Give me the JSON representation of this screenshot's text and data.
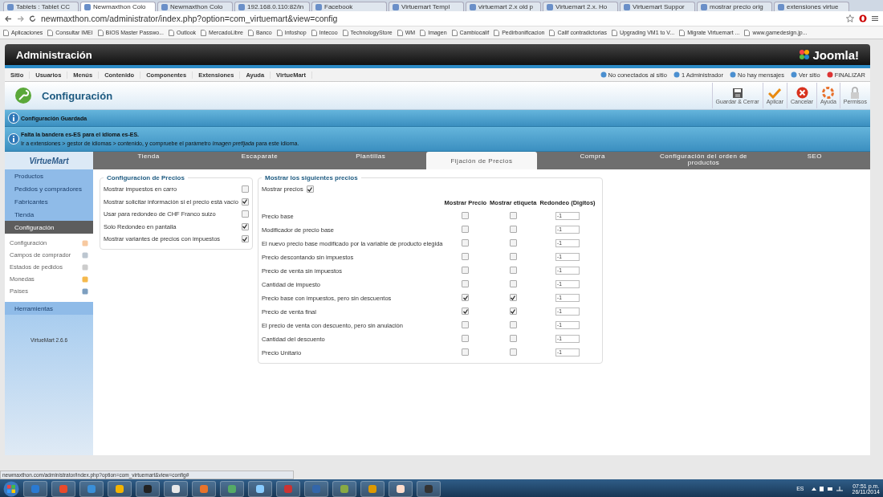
{
  "browser": {
    "tabs": [
      {
        "title": "Tablets : Tablet CC",
        "selected": false
      },
      {
        "title": "Newmaxthon Colo",
        "selected": true
      },
      {
        "title": "Newmaxthon Colo",
        "selected": false
      },
      {
        "title": "192.168.0.110:82/in",
        "selected": false
      },
      {
        "title": "Facebook",
        "selected": false
      },
      {
        "title": "Virtuemart Templ",
        "selected": false
      },
      {
        "title": "virtuemart 2.x old p",
        "selected": false
      },
      {
        "title": "Virtuemart 2.x. Ho",
        "selected": false
      },
      {
        "title": "Virtuemart Suppor",
        "selected": false
      },
      {
        "title": "mostrar precio orig",
        "selected": false
      },
      {
        "title": "extensiones virtue",
        "selected": false
      }
    ],
    "address": "newmaxthon.com/administrator/index.php?option=com_virtuemart&view=config",
    "bookmarks": [
      "Aplicaciones",
      "Consultar IMEI",
      "BIOS Master Passwo...",
      "Outlook",
      "MercadoLibre",
      "Banco",
      "Infoshop",
      "Intecoo",
      "TechnologyStore",
      "WM",
      "Imagen",
      "Cambiocalif",
      "Pedirbonificacion",
      "Calif contradictorias",
      "Upgrading VM1 to V...",
      "Migrate Virtuemart ...",
      "www.gamedesign.jp..."
    ],
    "status_url": "newmaxthon.com/administrator/index.php?option=com_virtuemart&view=config#"
  },
  "header": {
    "title": "Administración",
    "logo": "Joomla!"
  },
  "menu": [
    "Sitio",
    "Usuarios",
    "Menús",
    "Contenido",
    "Componentes",
    "Extensiones",
    "Ayuda",
    "VirtueMart"
  ],
  "status_links": [
    "No conectados al sitio",
    "1 Administrador",
    "No hay mensajes",
    "Ver sitio",
    "FINALIZAR"
  ],
  "toolbar": {
    "title": "Configuración",
    "buttons": [
      {
        "label": "Guardar & Cerrar",
        "kind": "save"
      },
      {
        "label": "Aplicar",
        "kind": "apply"
      },
      {
        "label": "Cancelar",
        "kind": "cancel"
      },
      {
        "label": "Ayuda",
        "kind": "help"
      },
      {
        "label": "Permisos",
        "kind": "lock"
      }
    ]
  },
  "messages": [
    {
      "lines": [
        "**Configuración Guardada**"
      ]
    },
    {
      "lines": [
        "**Falta la bandera es-ES para el idioma es-ES.**",
        "Ir a extensiones > gestor de idiomas > contenido, y compruebe el parámetro *Imagen prefijada* para este idioma."
      ]
    }
  ],
  "sidebar": {
    "logo": "VirtueMart",
    "sections": [
      {
        "label": "Productos",
        "selected": false
      },
      {
        "label": "Pedidos y compradores",
        "selected": false
      },
      {
        "label": "Fabricantes",
        "selected": false
      },
      {
        "label": "Tienda",
        "selected": false
      },
      {
        "label": "Configuración",
        "selected": true
      }
    ],
    "subitems": [
      "Configuración",
      "Campos de comprador",
      "Estados de pedidos",
      "Monedas",
      "Países"
    ],
    "tools": "Herramientas",
    "version": "VirtueMart 2.6.6"
  },
  "tabs": [
    {
      "label": "Tienda",
      "selected": false
    },
    {
      "label": "Escaparate",
      "selected": false
    },
    {
      "label": "Plantillas",
      "selected": false
    },
    {
      "label": "Fijación de Precios",
      "selected": true
    },
    {
      "label": "Compra",
      "selected": false
    },
    {
      "label": "Configuración del orden de productos",
      "selected": false
    },
    {
      "label": "SEO",
      "selected": false
    }
  ],
  "price_config": {
    "title": "Configuracion de Precios",
    "options": [
      {
        "label": "Mostrar impuestos en carro",
        "checked": false
      },
      {
        "label": "Mostrar solicitar información si el precio está vacío",
        "checked": true
      },
      {
        "label": "Usar para redondeo de CHF Franco suizo",
        "checked": false
      },
      {
        "label": "Solo Redondeo en pantalla",
        "checked": true
      },
      {
        "label": "Mostrar variantes de precios con impuestos",
        "checked": true
      }
    ]
  },
  "prices": {
    "title": "Mostrar los siguientes precios",
    "show_prices": {
      "label": "Mostrar precios",
      "checked": true
    },
    "columns": [
      "Mostrar Precio",
      "Mostrar etiqueta",
      "Redondeo (Digitos)"
    ],
    "rows": [
      {
        "label": "Precio base",
        "show_price": false,
        "show_label": false,
        "rounding": "-1"
      },
      {
        "label": "Modificador de precio base",
        "show_price": false,
        "show_label": false,
        "rounding": "-1"
      },
      {
        "label": "El nuevo precio base modificado por la variable de producto elegida",
        "show_price": false,
        "show_label": false,
        "rounding": "-1"
      },
      {
        "label": "Precio descontando sin impuestos",
        "show_price": false,
        "show_label": false,
        "rounding": "-1"
      },
      {
        "label": "Precio de venta sin impuestos",
        "show_price": false,
        "show_label": false,
        "rounding": "-1"
      },
      {
        "label": "Cantidad de impuesto",
        "show_price": false,
        "show_label": false,
        "rounding": "-1"
      },
      {
        "label": "Precio base con impuestos, pero sin descuentos",
        "show_price": true,
        "show_label": true,
        "rounding": "-1"
      },
      {
        "label": "Precio de venta final",
        "show_price": true,
        "show_label": true,
        "rounding": "-1"
      },
      {
        "label": "El precio de venta con descuento, pero sin anulación",
        "show_price": false,
        "show_label": false,
        "rounding": "-1"
      },
      {
        "label": "Cantidad del descuento",
        "show_price": false,
        "show_label": false,
        "rounding": "-1"
      },
      {
        "label": "Precio Unitario",
        "show_price": false,
        "show_label": false,
        "rounding": "-1"
      }
    ]
  },
  "taskbar": {
    "language": "ES",
    "time": "07:51 p.m.",
    "date": "26/11/2014"
  }
}
